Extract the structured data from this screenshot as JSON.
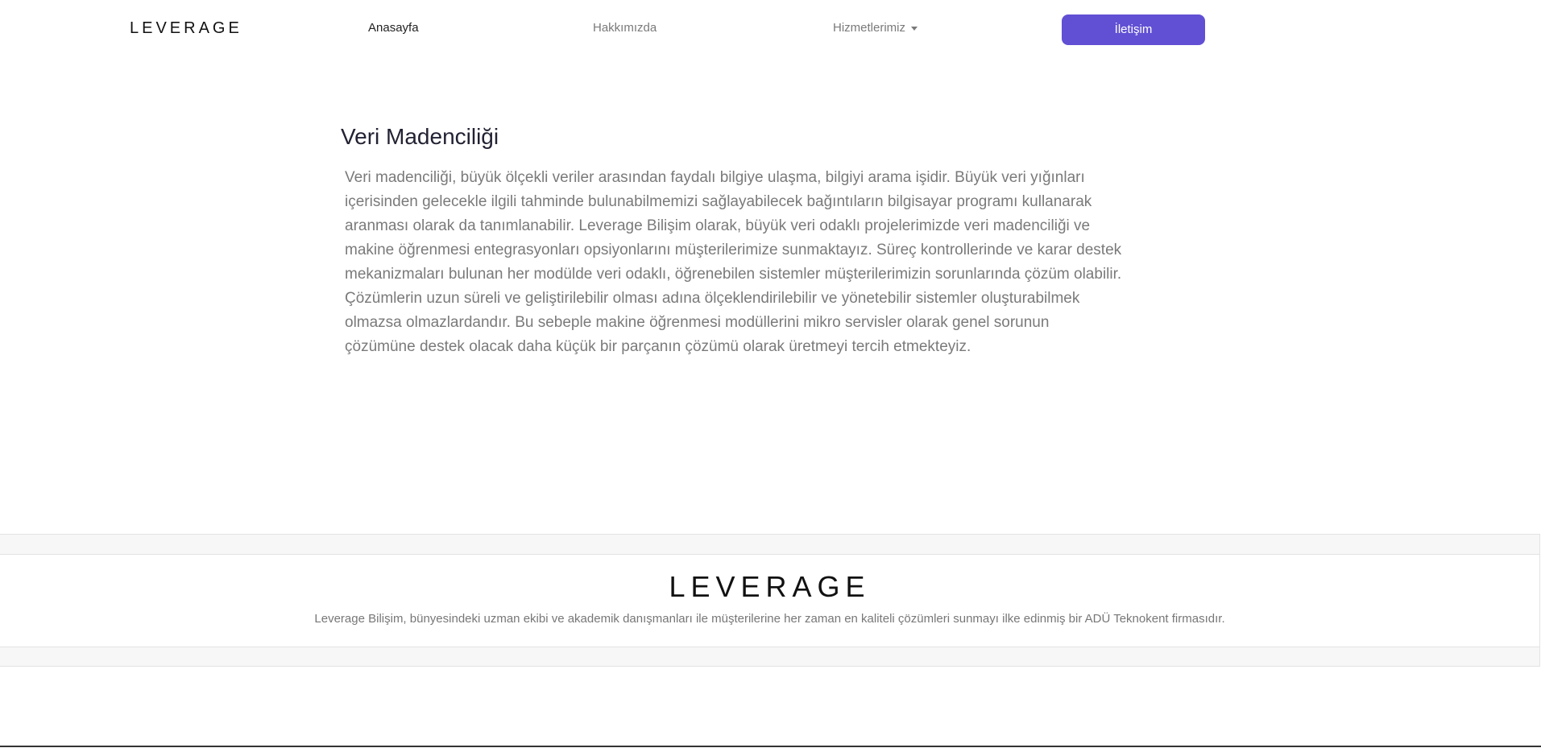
{
  "navbar": {
    "logo": "LEVERAGE",
    "links": [
      {
        "label": "Anasayfa"
      },
      {
        "label": "Hakkımızda"
      },
      {
        "label": "Hizmetlerimiz"
      }
    ],
    "contact_label": "İletişim"
  },
  "main": {
    "title": "Veri Madenciliği",
    "body": "Veri madenciliği, büyük ölçekli veriler arasından faydalı bilgiye ulaşma, bilgiyi arama işidir. Büyük veri yığınları içerisinden gelecekle ilgili tahminde bulunabilmemizi sağlayabilecek bağıntıların bilgisayar programı kullanarak aranması olarak da tanımlanabilir. Leverage Bilişim olarak, büyük veri odaklı projelerimizde veri madenciliği ve makine öğrenmesi entegrasyonları opsiyonlarını müşterilerimize sunmaktayız. Süreç kontrollerinde ve karar destek mekanizmaları bulunan her modülde veri odaklı, öğrenebilen sistemler müşterilerimizin sorunlarında çözüm olabilir. Çözümlerin uzun süreli ve geliştirilebilir olması adına ölçeklendirilebilir ve yönetebilir sistemler oluşturabilmek olmazsa olmazlardandır. Bu sebeple makine öğrenmesi modüllerini mikro servisler olarak genel sorunun çözümüne destek olacak daha küçük bir parçanın çözümü olarak üretmeyi tercih etmekteyiz."
  },
  "footer": {
    "logo": "LEVERAGE",
    "description": "Leverage Bilişim, bünyesindeki uzman ekibi ve akademik danışmanları ile müşterilerine her zaman en kaliteli çözümleri sunmayı ilke edinmiş bir ADÜ Teknokent firmasıdır."
  },
  "colors": {
    "accent": "#6150d4",
    "muted_text": "#7a7a7a",
    "footer_band": "#f7f7f7"
  },
  "icons": {
    "dropdown": "caret-down-icon"
  }
}
